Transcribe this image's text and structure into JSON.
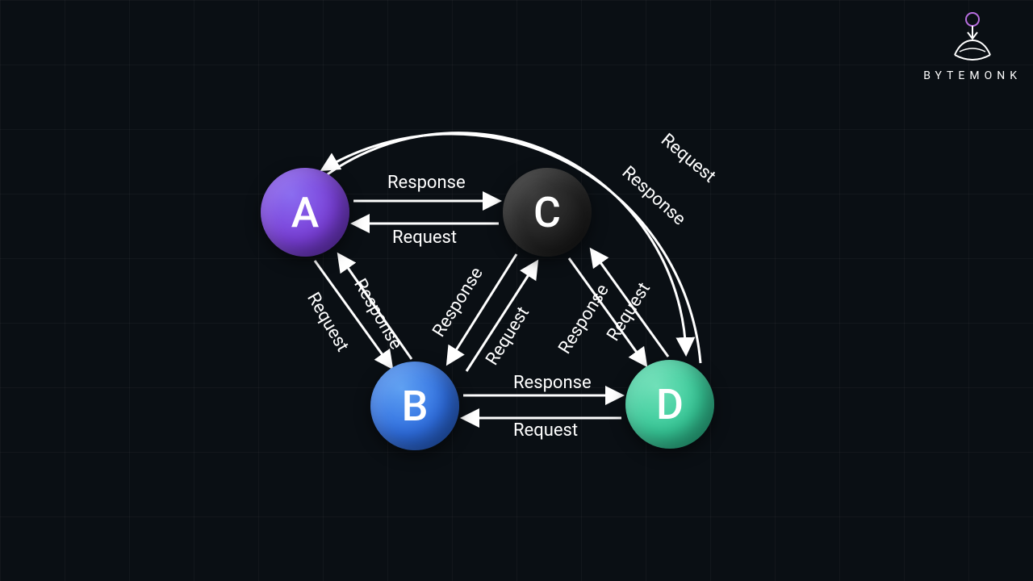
{
  "brand": {
    "name": "BYTEMONK"
  },
  "nodes": {
    "a": "A",
    "b": "B",
    "c": "C",
    "d": "D"
  },
  "labels": {
    "request": "Request",
    "response": "Response"
  },
  "edges": {
    "ac_top": "Response",
    "ac_bottom": "Request",
    "ab_left": "Request",
    "ab_right": "Response",
    "cb_left": "Response",
    "cb_right": "Request",
    "cd_left": "Response",
    "cd_right": "Request",
    "bd_top": "Response",
    "bd_bottom": "Request",
    "da_outer": "Request",
    "da_inner": "Response"
  }
}
